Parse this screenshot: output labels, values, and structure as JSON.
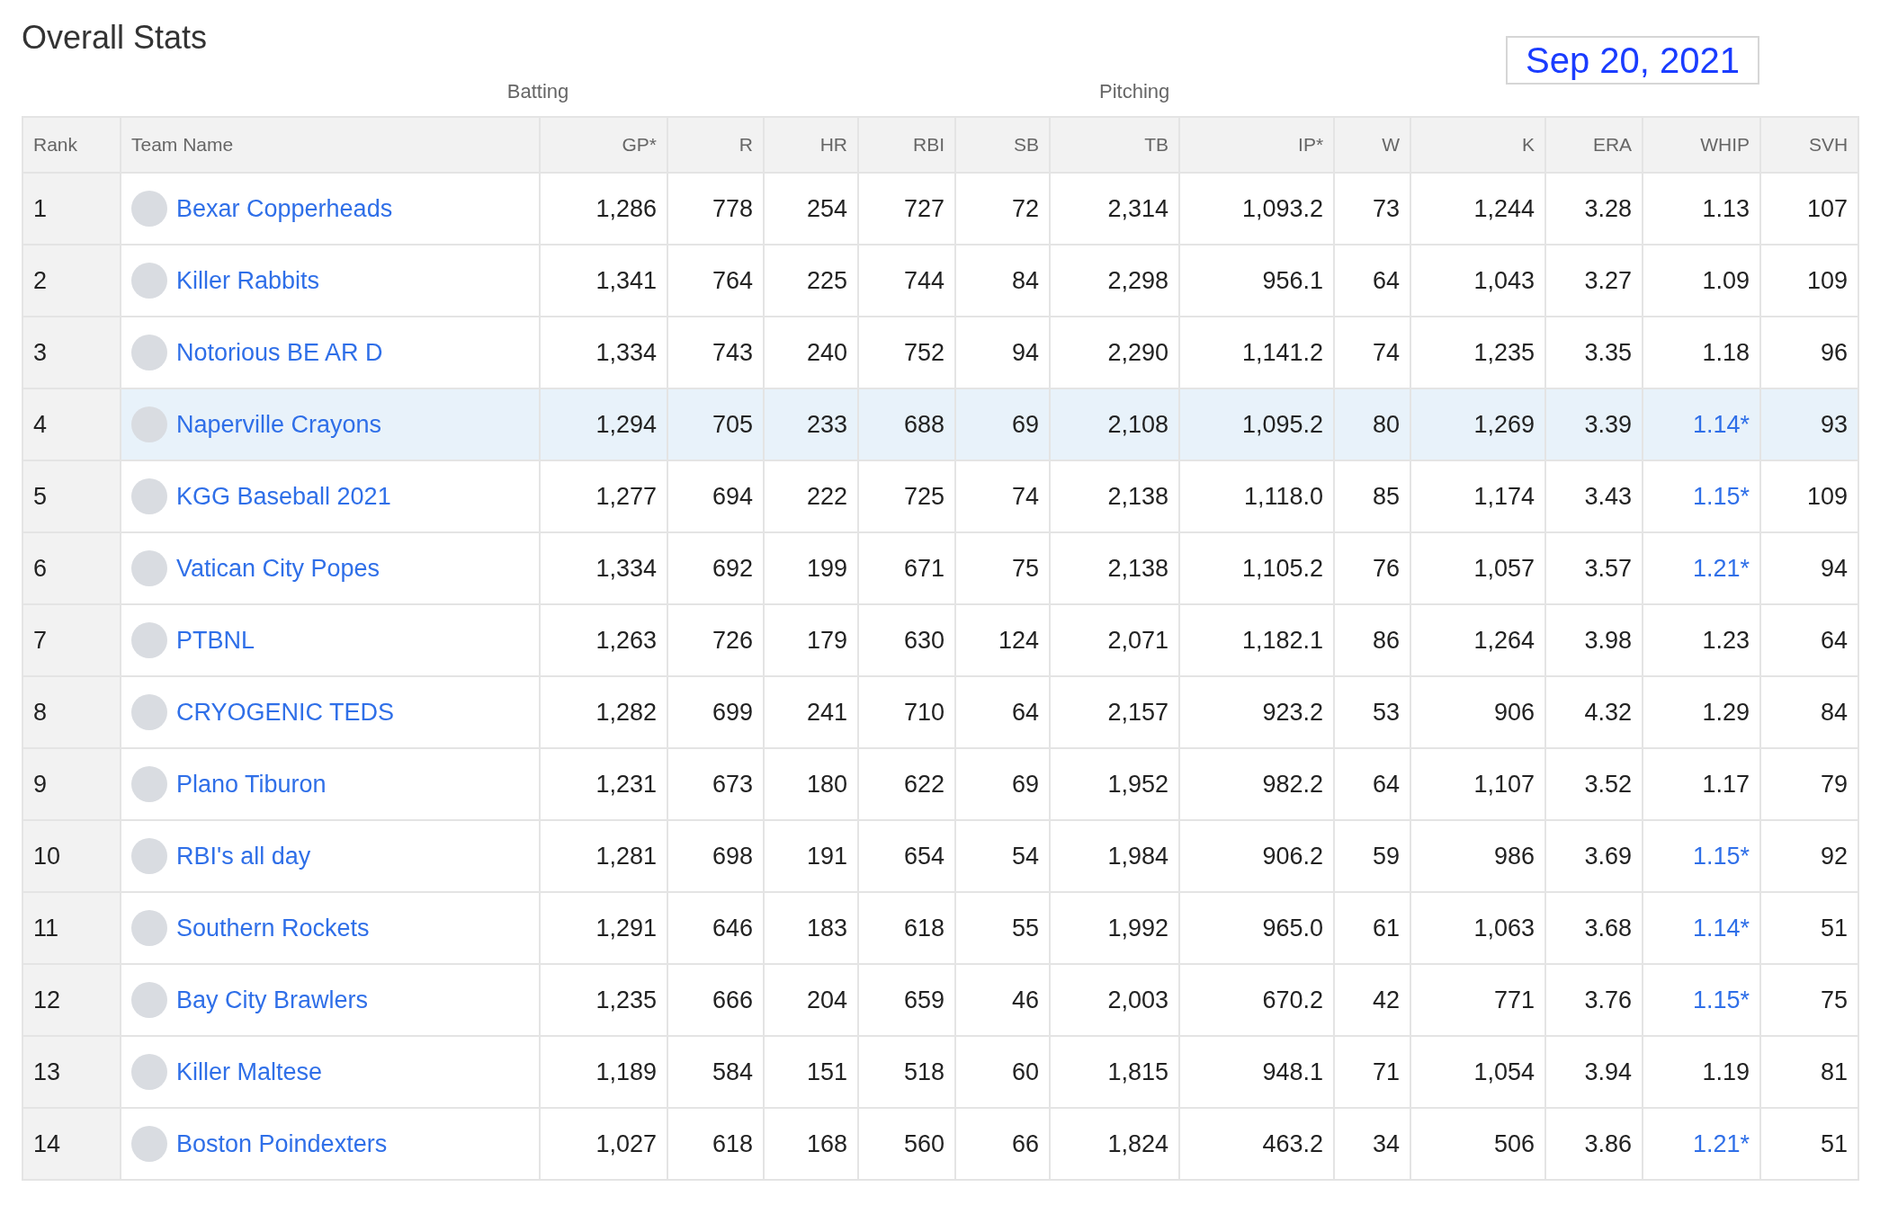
{
  "title": "Overall Stats",
  "date": "Sep 20, 2021",
  "groups": [
    "Batting",
    "Pitching"
  ],
  "columns": [
    "Rank",
    "Team Name",
    "GP*",
    "R",
    "HR",
    "RBI",
    "SB",
    "TB",
    "IP*",
    "W",
    "K",
    "ERA",
    "WHIP",
    "SVH"
  ],
  "rows": [
    {
      "rank": "1",
      "team": "Bexar Copperheads",
      "selected": false,
      "stats": [
        "1,286",
        "778",
        "254",
        "727",
        "72",
        "2,314",
        "1,093.2",
        "73",
        "1,244",
        "3.28"
      ],
      "whip": {
        "value": "1.13",
        "linked": false
      },
      "svh": "107"
    },
    {
      "rank": "2",
      "team": "Killer Rabbits",
      "selected": false,
      "stats": [
        "1,341",
        "764",
        "225",
        "744",
        "84",
        "2,298",
        "956.1",
        "64",
        "1,043",
        "3.27"
      ],
      "whip": {
        "value": "1.09",
        "linked": false
      },
      "svh": "109"
    },
    {
      "rank": "3",
      "team": "Notorious BE AR D",
      "selected": false,
      "stats": [
        "1,334",
        "743",
        "240",
        "752",
        "94",
        "2,290",
        "1,141.2",
        "74",
        "1,235",
        "3.35"
      ],
      "whip": {
        "value": "1.18",
        "linked": false
      },
      "svh": "96"
    },
    {
      "rank": "4",
      "team": "Naperville Crayons",
      "selected": true,
      "stats": [
        "1,294",
        "705",
        "233",
        "688",
        "69",
        "2,108",
        "1,095.2",
        "80",
        "1,269",
        "3.39"
      ],
      "whip": {
        "value": "1.14*",
        "linked": true
      },
      "svh": "93"
    },
    {
      "rank": "5",
      "team": "KGG Baseball 2021",
      "selected": false,
      "stats": [
        "1,277",
        "694",
        "222",
        "725",
        "74",
        "2,138",
        "1,118.0",
        "85",
        "1,174",
        "3.43"
      ],
      "whip": {
        "value": "1.15*",
        "linked": true
      },
      "svh": "109"
    },
    {
      "rank": "6",
      "team": "Vatican City Popes",
      "selected": false,
      "stats": [
        "1,334",
        "692",
        "199",
        "671",
        "75",
        "2,138",
        "1,105.2",
        "76",
        "1,057",
        "3.57"
      ],
      "whip": {
        "value": "1.21*",
        "linked": true
      },
      "svh": "94"
    },
    {
      "rank": "7",
      "team": "PTBNL",
      "selected": false,
      "stats": [
        "1,263",
        "726",
        "179",
        "630",
        "124",
        "2,071",
        "1,182.1",
        "86",
        "1,264",
        "3.98"
      ],
      "whip": {
        "value": "1.23",
        "linked": false
      },
      "svh": "64"
    },
    {
      "rank": "8",
      "team": "CRYOGENIC TEDS",
      "selected": false,
      "stats": [
        "1,282",
        "699",
        "241",
        "710",
        "64",
        "2,157",
        "923.2",
        "53",
        "906",
        "4.32"
      ],
      "whip": {
        "value": "1.29",
        "linked": false
      },
      "svh": "84"
    },
    {
      "rank": "9",
      "team": "Plano Tiburon",
      "selected": false,
      "stats": [
        "1,231",
        "673",
        "180",
        "622",
        "69",
        "1,952",
        "982.2",
        "64",
        "1,107",
        "3.52"
      ],
      "whip": {
        "value": "1.17",
        "linked": false
      },
      "svh": "79"
    },
    {
      "rank": "10",
      "team": "RBI's all day",
      "selected": false,
      "stats": [
        "1,281",
        "698",
        "191",
        "654",
        "54",
        "1,984",
        "906.2",
        "59",
        "986",
        "3.69"
      ],
      "whip": {
        "value": "1.15*",
        "linked": true
      },
      "svh": "92"
    },
    {
      "rank": "11",
      "team": "Southern Rockets",
      "selected": false,
      "stats": [
        "1,291",
        "646",
        "183",
        "618",
        "55",
        "1,992",
        "965.0",
        "61",
        "1,063",
        "3.68"
      ],
      "whip": {
        "value": "1.14*",
        "linked": true
      },
      "svh": "51"
    },
    {
      "rank": "12",
      "team": "Bay City Brawlers",
      "selected": false,
      "stats": [
        "1,235",
        "666",
        "204",
        "659",
        "46",
        "2,003",
        "670.2",
        "42",
        "771",
        "3.76"
      ],
      "whip": {
        "value": "1.15*",
        "linked": true
      },
      "svh": "75"
    },
    {
      "rank": "13",
      "team": "Killer Maltese",
      "selected": false,
      "stats": [
        "1,189",
        "584",
        "151",
        "518",
        "60",
        "1,815",
        "948.1",
        "71",
        "1,054",
        "3.94"
      ],
      "whip": {
        "value": "1.19",
        "linked": false
      },
      "svh": "81"
    },
    {
      "rank": "14",
      "team": "Boston Poindexters",
      "selected": false,
      "stats": [
        "1,027",
        "618",
        "168",
        "560",
        "66",
        "1,824",
        "463.2",
        "34",
        "506",
        "3.86"
      ],
      "whip": {
        "value": "1.21*",
        "linked": true
      },
      "svh": "51"
    }
  ]
}
